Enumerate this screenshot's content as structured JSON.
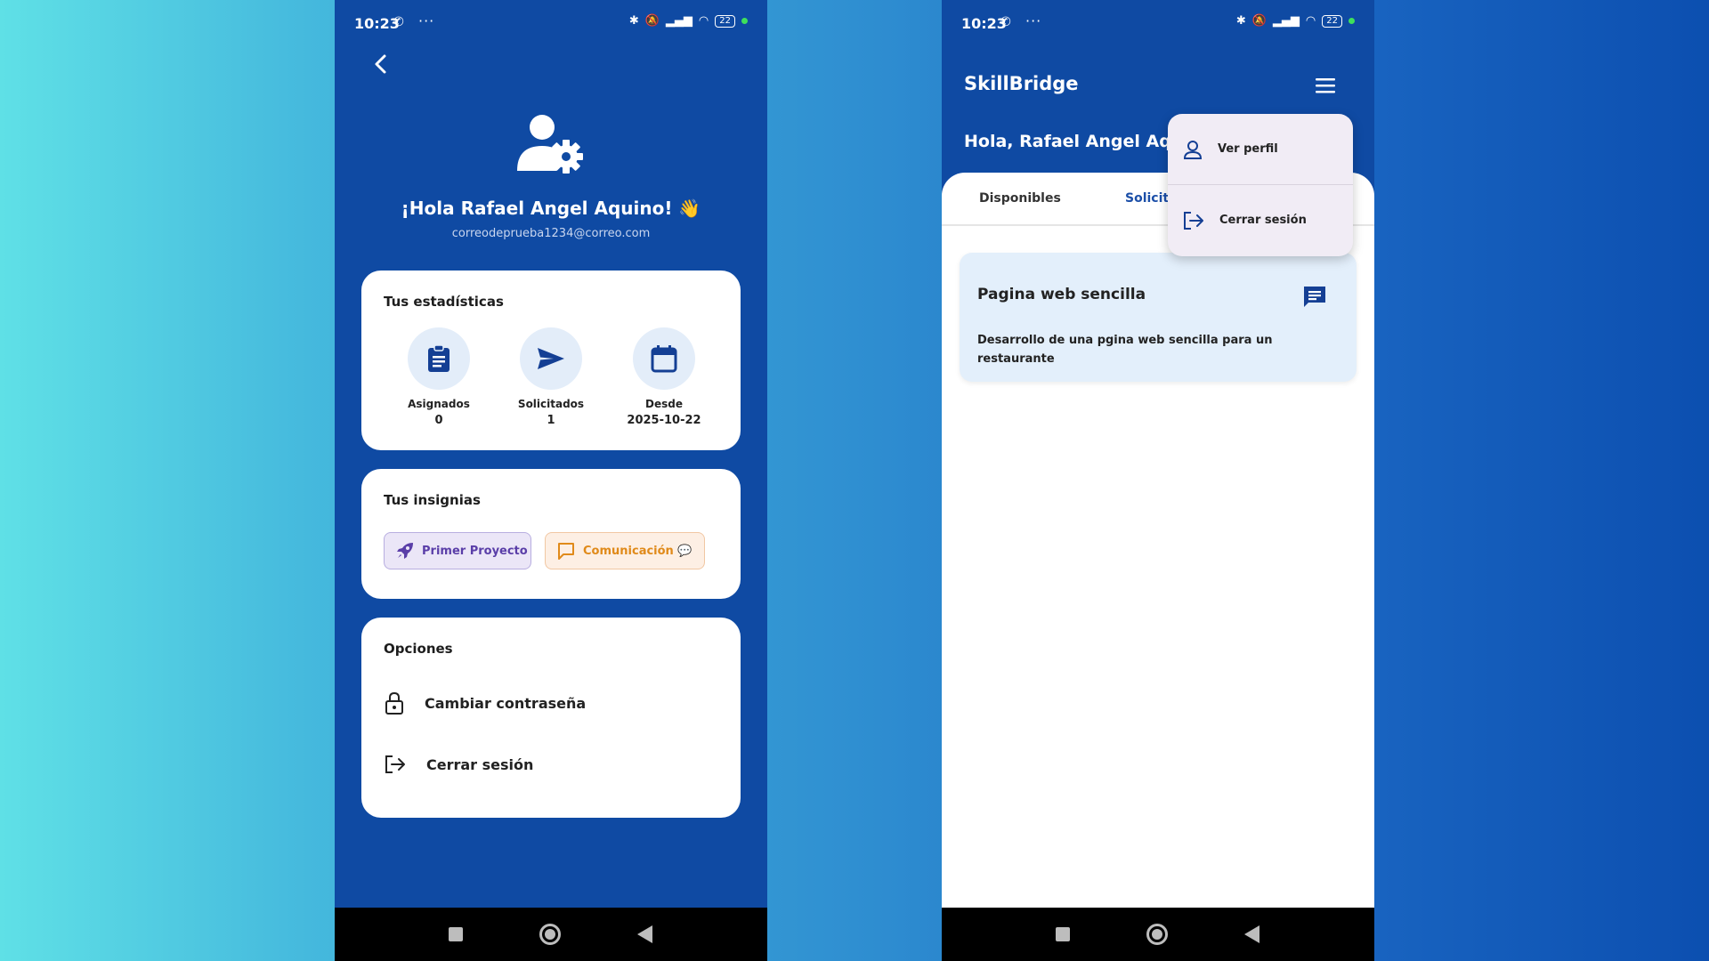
{
  "status_bar": {
    "time": "10:23",
    "battery": "22"
  },
  "profile_screen": {
    "greeting": "¡Hola Rafael Angel Aquino! 👋",
    "email": "correodeprueba1234@correo.com",
    "stats": {
      "title": "Tus estadísticas",
      "items": [
        {
          "label": "Asignados",
          "value": "0",
          "icon": "clipboard-icon"
        },
        {
          "label": "Solicitados",
          "value": "1",
          "icon": "send-icon"
        },
        {
          "label": "Desde",
          "value": "2025-10-22",
          "icon": "calendar-icon"
        }
      ]
    },
    "badges": {
      "title": "Tus insignias",
      "items": [
        {
          "label": "Primer Proyecto",
          "icon": "rocket-icon"
        },
        {
          "label": "Comunicación 💬",
          "icon": "chat-bubble-icon"
        }
      ]
    },
    "options": {
      "title": "Opciones",
      "items": [
        {
          "label": "Cambiar contraseña",
          "icon": "lock-icon"
        },
        {
          "label": "Cerrar sesión",
          "icon": "logout-icon"
        }
      ]
    }
  },
  "home_screen": {
    "app_title": "SkillBridge",
    "greeting": "Hola, Rafael Angel Aqui",
    "tabs": [
      "Disponibles",
      "Solicita"
    ],
    "task": {
      "title": "Pagina web sencilla",
      "description": "Desarrollo de una pgina web sencilla para un restaurante"
    },
    "menu": {
      "items": [
        {
          "label": "Ver perfil",
          "icon": "person-icon"
        },
        {
          "label": "Cerrar sesión",
          "icon": "logout-icon"
        }
      ]
    }
  },
  "colors": {
    "primary": "#0f4aa3",
    "card": "#ffffff",
    "accent_circle": "#e3edf9",
    "badge_purple": "#5a3ea8",
    "badge_orange": "#e08a1a"
  }
}
